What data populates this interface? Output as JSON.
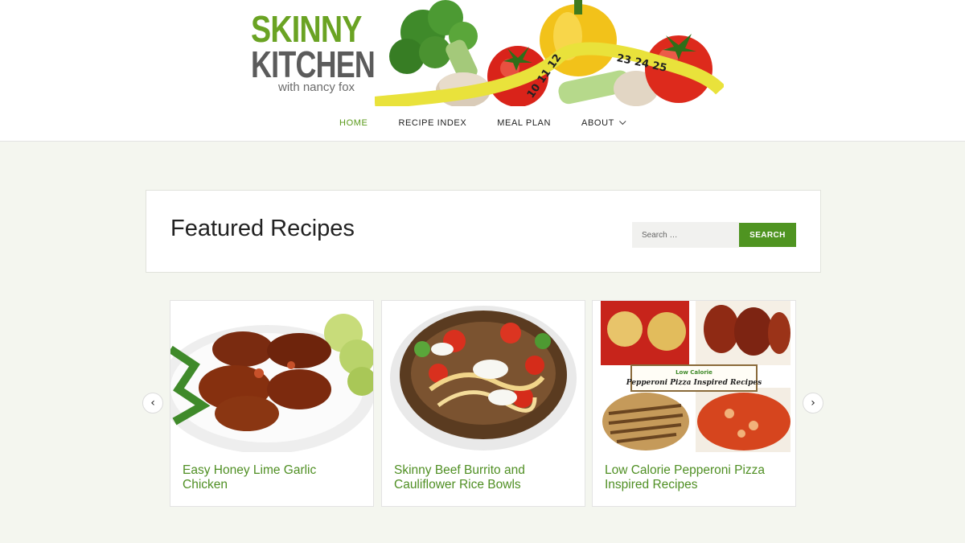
{
  "logo": {
    "line1": "SKINNY",
    "line2": "KITCHEN",
    "line3": "with nancy fox"
  },
  "nav": {
    "items": [
      {
        "label": "HOME"
      },
      {
        "label": "RECIPE INDEX"
      },
      {
        "label": "MEAL PLAN"
      },
      {
        "label": "ABOUT"
      }
    ]
  },
  "featured": {
    "title": "Featured Recipes",
    "search_placeholder": "Search …",
    "search_button": "SEARCH"
  },
  "carousel": {
    "prev_icon": "chevron-left-icon",
    "next_icon": "chevron-right-icon",
    "cards": [
      {
        "title": "Easy Honey Lime Garlic Chicken"
      },
      {
        "title": "Skinny Beef Burrito and Cauliflower Rice Bowls"
      },
      {
        "title": "Low Calorie Pepperoni Pizza Inspired Recipes",
        "image_caption_top": "Low Calorie",
        "image_caption": "Pepperoni Pizza Inspired Recipes"
      }
    ]
  },
  "colors": {
    "accent_green": "#4f9421",
    "link_green": "#4f8f23",
    "page_bg": "#f4f6ef"
  }
}
